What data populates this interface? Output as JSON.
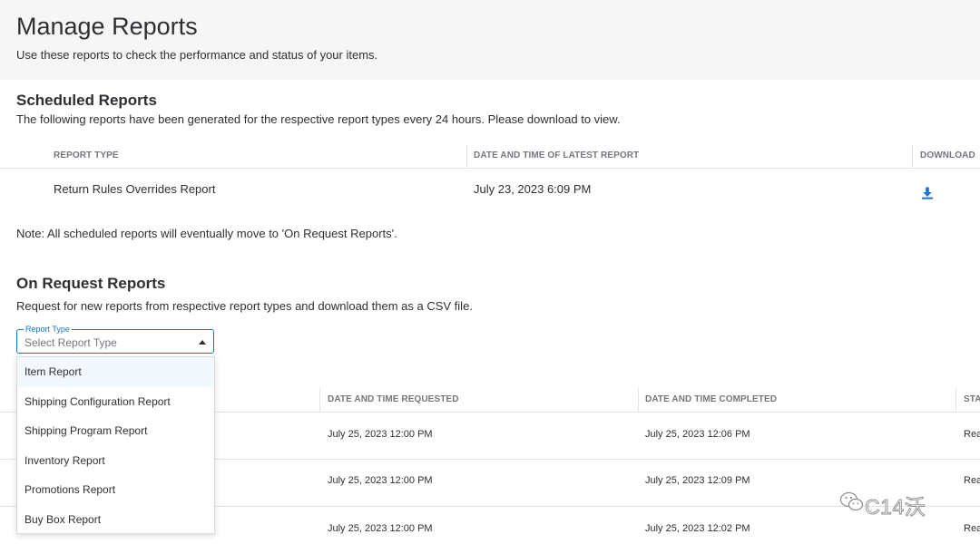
{
  "header": {
    "title": "Manage Reports",
    "subtitle": "Use these reports to check the performance and status of your items."
  },
  "scheduled": {
    "title": "Scheduled Reports",
    "description": "The following reports have been generated for the respective report types every 24 hours. Please download to view.",
    "columns": {
      "report_type": "REPORT TYPE",
      "latest": "DATE AND TIME OF LATEST REPORT",
      "download": "DOWNLOAD"
    },
    "rows": [
      {
        "report_type": "Return Rules Overrides Report",
        "latest": "July 23, 2023 6:09 PM",
        "download_icon": "download-icon"
      }
    ],
    "note": "Note: All scheduled reports will eventually move to 'On Request Reports'."
  },
  "on_request": {
    "title": "On Request Reports",
    "description": "Request for new reports from respective report types and download them as a CSV file.",
    "select": {
      "label": "Report Type",
      "placeholder": "Select Report Type",
      "expanded": true,
      "options": [
        "Item Report",
        "Shipping Configuration Report",
        "Shipping Program Report",
        "Inventory Report",
        "Promotions Report",
        "Buy Box Report"
      ]
    },
    "columns": {
      "requested": "DATE AND TIME REQUESTED",
      "completed": "DATE AND TIME COMPLETED",
      "status": "STAT"
    },
    "rows": [
      {
        "requested": "July 25, 2023 12:00 PM",
        "completed": "July 25, 2023 12:06 PM",
        "status": "Rea"
      },
      {
        "requested": "July 25, 2023 12:00 PM",
        "completed": "July 25, 2023 12:09 PM",
        "status": "Rea"
      },
      {
        "requested": "July 25, 2023 12:00 PM",
        "completed": "July 25, 2023 12:02 PM",
        "status": "Rea"
      }
    ]
  },
  "watermark": {
    "text": "C14沃",
    "icon": "wechat-icon"
  },
  "colors": {
    "accent": "#1a75cf",
    "header_bg": "#f6f6f6",
    "text": "#2e2f32",
    "muted": "#74767c"
  }
}
